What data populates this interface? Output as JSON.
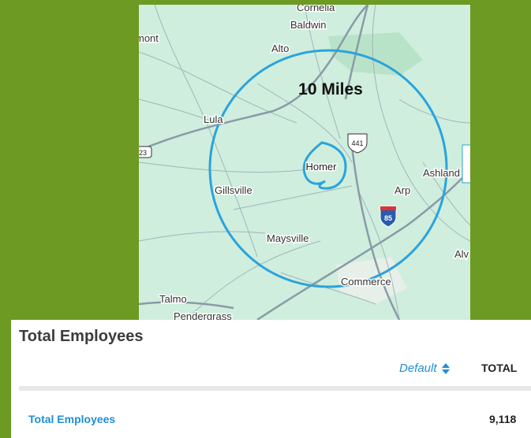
{
  "map": {
    "radius_label": "10 Miles",
    "places": {
      "cornelia": "Cornelia",
      "baldwin": "Baldwin",
      "mont": "mont",
      "alto": "Alto",
      "lula": "Lula",
      "homer": "Homer",
      "ashland": "Ashland",
      "gillsville": "Gillsville",
      "arp": "Arp",
      "maysville": "Maysville",
      "alv": "Alv",
      "commerce": "Commerce",
      "talmo": "Talmo",
      "pendergrass": "Pendergrass"
    },
    "shields": {
      "us441": "441",
      "i85": "85",
      "route23": "23"
    },
    "colors": {
      "radius_circle": "#2ba3dc",
      "land": "#cfeedd",
      "roads": "#9aa8b5"
    }
  },
  "panel": {
    "title": "Total Employees",
    "sort_label": "Default",
    "column_header": "TOTAL",
    "rows": [
      {
        "label": "Total Employees",
        "value": "9,118"
      }
    ]
  }
}
